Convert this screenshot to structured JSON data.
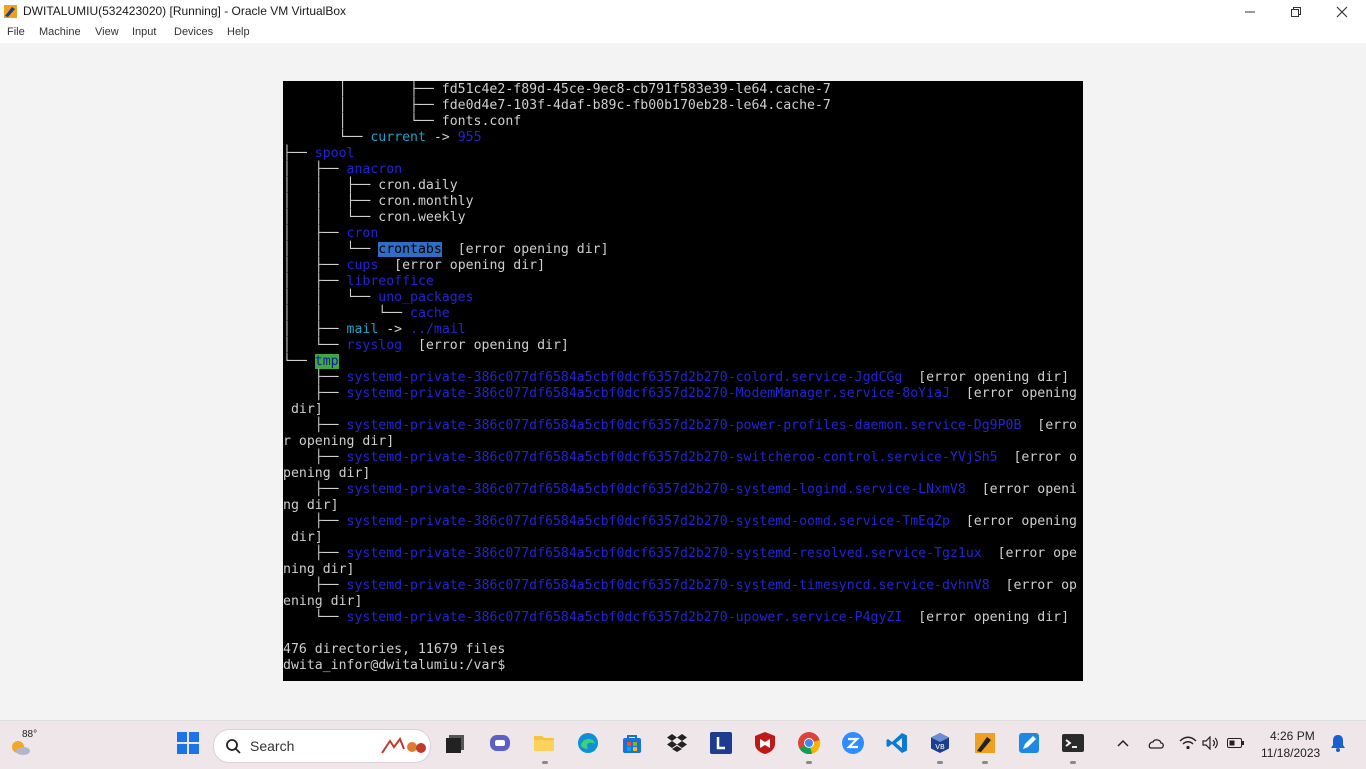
{
  "window": {
    "title": "DWITALUMIU(532423020) [Running] - Oracle VM VirtualBox",
    "minimize_icon": "minimize-icon",
    "maximize_icon": "restore-icon",
    "close_icon": "close-icon"
  },
  "menu": [
    "File",
    "Machine",
    "View",
    "Input",
    "Devices",
    "Help"
  ],
  "terminal": {
    "colors": {
      "dir": "#2323d6",
      "link": "#19a3c9",
      "file": "#cfcfcf",
      "highlight": "#2f6ec4",
      "sticky": "#3fa93f"
    },
    "lines": [
      [
        [
          "tr",
          "       │        ├── "
        ],
        [
          "f",
          "fd51c4e2-f89d-45ce-9ec8-cb791f583e39-le64.cache-7"
        ]
      ],
      [
        [
          "tr",
          "       │        ├── "
        ],
        [
          "f",
          "fde0d4e7-103f-4daf-b89c-fb00b170eb28-le64.cache-7"
        ]
      ],
      [
        [
          "tr",
          "       │        └── "
        ],
        [
          "f",
          "fonts.conf"
        ]
      ],
      [
        [
          "tr",
          "       └── "
        ],
        [
          "c",
          "current"
        ],
        [
          "f",
          " -> "
        ],
        [
          "d",
          "955"
        ]
      ],
      [
        [
          "tr",
          "├── "
        ],
        [
          "d",
          "spool"
        ]
      ],
      [
        [
          "tr",
          "│   ├── "
        ],
        [
          "d",
          "anacron"
        ]
      ],
      [
        [
          "tr",
          "│   │   ├── "
        ],
        [
          "f",
          "cron.daily"
        ]
      ],
      [
        [
          "tr",
          "│   │   ├── "
        ],
        [
          "f",
          "cron.monthly"
        ]
      ],
      [
        [
          "tr",
          "│   │   └── "
        ],
        [
          "f",
          "cron.weekly"
        ]
      ],
      [
        [
          "tr",
          "│   ├── "
        ],
        [
          "d",
          "cron"
        ]
      ],
      [
        [
          "tr",
          "│   │   └── "
        ],
        [
          "hl",
          "crontabs"
        ],
        [
          "f",
          "  [error opening dir]"
        ]
      ],
      [
        [
          "tr",
          "│   ├── "
        ],
        [
          "d",
          "cups"
        ],
        [
          "f",
          "  [error opening dir]"
        ]
      ],
      [
        [
          "tr",
          "│   ├── "
        ],
        [
          "d",
          "libreoffice"
        ]
      ],
      [
        [
          "tr",
          "│   │   └── "
        ],
        [
          "d",
          "uno_packages"
        ]
      ],
      [
        [
          "tr",
          "│   │       └── "
        ],
        [
          "d",
          "cache"
        ]
      ],
      [
        [
          "tr",
          "│   ├── "
        ],
        [
          "c",
          "mail"
        ],
        [
          "f",
          " -> "
        ],
        [
          "d",
          "../mail"
        ]
      ],
      [
        [
          "tr",
          "│   └── "
        ],
        [
          "d",
          "rsyslog"
        ],
        [
          "f",
          "  [error opening dir]"
        ]
      ],
      [
        [
          "tr",
          "└── "
        ],
        [
          "gh",
          "tmp"
        ]
      ],
      [
        [
          "tr",
          "    ├── "
        ],
        [
          "d",
          "systemd-private-386c077df6584a5cbf0dcf6357d2b270-colord.service-JgdCGg"
        ],
        [
          "f",
          "  [error opening dir]"
        ]
      ],
      [
        [
          "tr",
          "    ├── "
        ],
        [
          "d",
          "systemd-private-386c077df6584a5cbf0dcf6357d2b270-ModemManager.service-8oYiaJ"
        ],
        [
          "f",
          "  [error opening"
        ]
      ],
      [
        [
          "f",
          " dir]"
        ]
      ],
      [
        [
          "tr",
          "    ├── "
        ],
        [
          "d",
          "systemd-private-386c077df6584a5cbf0dcf6357d2b270-power-profiles-daemon.service-Dg9P0B"
        ],
        [
          "f",
          "  [erro"
        ]
      ],
      [
        [
          "f",
          "r opening dir]"
        ]
      ],
      [
        [
          "tr",
          "    ├── "
        ],
        [
          "d",
          "systemd-private-386c077df6584a5cbf0dcf6357d2b270-switcheroo-control.service-YVjSh5"
        ],
        [
          "f",
          "  [error o"
        ]
      ],
      [
        [
          "f",
          "pening dir]"
        ]
      ],
      [
        [
          "tr",
          "    ├── "
        ],
        [
          "d",
          "systemd-private-386c077df6584a5cbf0dcf6357d2b270-systemd-logind.service-LNxmV8"
        ],
        [
          "f",
          "  [error openi"
        ]
      ],
      [
        [
          "f",
          "ng dir]"
        ]
      ],
      [
        [
          "tr",
          "    ├── "
        ],
        [
          "d",
          "systemd-private-386c077df6584a5cbf0dcf6357d2b270-systemd-oomd.service-TmEqZp"
        ],
        [
          "f",
          "  [error opening"
        ]
      ],
      [
        [
          "f",
          " dir]"
        ]
      ],
      [
        [
          "tr",
          "    ├── "
        ],
        [
          "d",
          "systemd-private-386c077df6584a5cbf0dcf6357d2b270-systemd-resolved.service-Tgz1ux"
        ],
        [
          "f",
          "  [error ope"
        ]
      ],
      [
        [
          "f",
          "ning dir]"
        ]
      ],
      [
        [
          "tr",
          "    ├── "
        ],
        [
          "d",
          "systemd-private-386c077df6584a5cbf0dcf6357d2b270-systemd-timesyncd.service-dvhnV8"
        ],
        [
          "f",
          "  [error op"
        ]
      ],
      [
        [
          "f",
          "ening dir]"
        ]
      ],
      [
        [
          "tr",
          "    └── "
        ],
        [
          "d",
          "systemd-private-386c077df6584a5cbf0dcf6357d2b270-upower.service-P4gyZI"
        ],
        [
          "f",
          "  [error opening dir]"
        ]
      ],
      [
        [
          "f",
          ""
        ]
      ],
      [
        [
          "f",
          "476 directories, 11679 files"
        ]
      ],
      [
        [
          "f",
          "dwita_infor@dwitalumiu:/var$ "
        ]
      ]
    ]
  },
  "taskbar": {
    "weather_temp": "88°",
    "search_label": "Search",
    "apps": [
      "start-icon",
      "task-view-icon",
      "teams-chat-icon",
      "file-explorer-icon",
      "edge-icon",
      "store-icon",
      "dropbox-icon",
      "lastpass-icon",
      "mcafee-icon",
      "chrome-icon",
      "zoom-icon",
      "vscode-icon",
      "virtualbox-icon",
      "tool-icon",
      "pencil-app-icon",
      "terminal-icon"
    ],
    "tray": [
      "chevron-up-icon",
      "cloud-icon",
      "wifi-icon",
      "speaker-icon",
      "battery-icon",
      "bell-icon"
    ],
    "time": "4:26 PM",
    "date": "11/18/2023"
  }
}
